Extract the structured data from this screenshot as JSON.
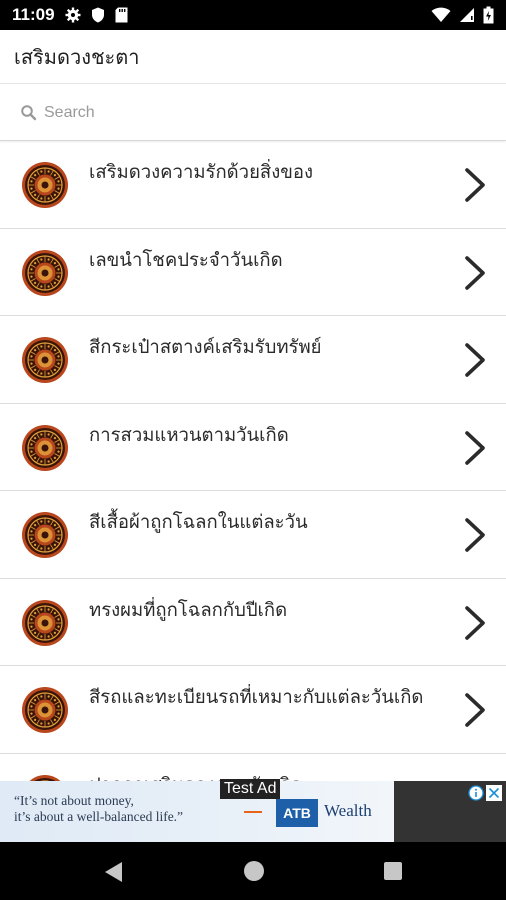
{
  "status_bar": {
    "time": "11:09",
    "icons_left": [
      "gear-icon",
      "shield-icon",
      "sd-card-icon"
    ],
    "icons_right": [
      "wifi-icon",
      "signal-icon",
      "battery-icon"
    ]
  },
  "app_bar": {
    "title": "เสริมดวงชะตา"
  },
  "search": {
    "placeholder": "Search",
    "value": ""
  },
  "list": {
    "items": [
      {
        "label": "เสริมดวงความรักด้วยสิ่งของ"
      },
      {
        "label": "เลขนำโชคประจำวันเกิด"
      },
      {
        "label": "สีกระเป๋าสตางค์เสริมรับทรัพย์"
      },
      {
        "label": "การสวมแหวนตามวันเกิด"
      },
      {
        "label": "สีเสื้อผ้าถูกโฉลกในแต่ละวัน"
      },
      {
        "label": "ทรงผมที่ถูกโฉลกกับปีเกิด"
      },
      {
        "label": "สีรถและทะเบียนรถที่เหมาะกับแต่ละวันเกิด"
      },
      {
        "label": "ปากกาเสริมดวงตามวันเกิด"
      }
    ]
  },
  "ad": {
    "tag": "Test Ad",
    "quote_line1": "“It’s not about money,",
    "quote_line2": "it’s about a well-balanced life.”",
    "brand": "ATB",
    "brand_word": "Wealth",
    "colors": {
      "brand_blue": "#1d5fa8",
      "accent_orange": "#e8631c"
    }
  },
  "nav_bar": {
    "icons": [
      "back-icon",
      "home-icon",
      "recents-icon"
    ]
  },
  "colors": {
    "avatar_ring": "#b8471c",
    "avatar_dark": "#3a1408",
    "avatar_gold": "#e0a13a",
    "chevron": "#2b2b2b",
    "divider": "#dcdcdc"
  }
}
